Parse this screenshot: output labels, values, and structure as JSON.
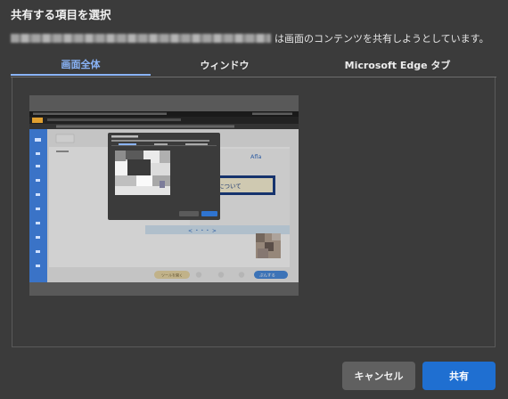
{
  "dialog": {
    "title": "共有する項目を選択",
    "subtitle_suffix": "は画面のコンテンツを共有しようとしています。"
  },
  "tabs": [
    {
      "label": "画面全体",
      "selected": true
    },
    {
      "label": "ウィンドウ",
      "selected": false
    },
    {
      "label": "Microsoft Edge タブ",
      "selected": false
    }
  ],
  "preview": {
    "brand_text": "Afla",
    "banner_text": "について",
    "pagination_text": "< ・・・ >",
    "pill_text": "ツールを開く",
    "primary_pill_text": "ぷんする"
  },
  "buttons": {
    "cancel": "キャンセル",
    "share": "共有"
  },
  "colors": {
    "accent": "#8ab4f8",
    "share_button": "#1f6fd1",
    "background": "#3b3b3b"
  }
}
